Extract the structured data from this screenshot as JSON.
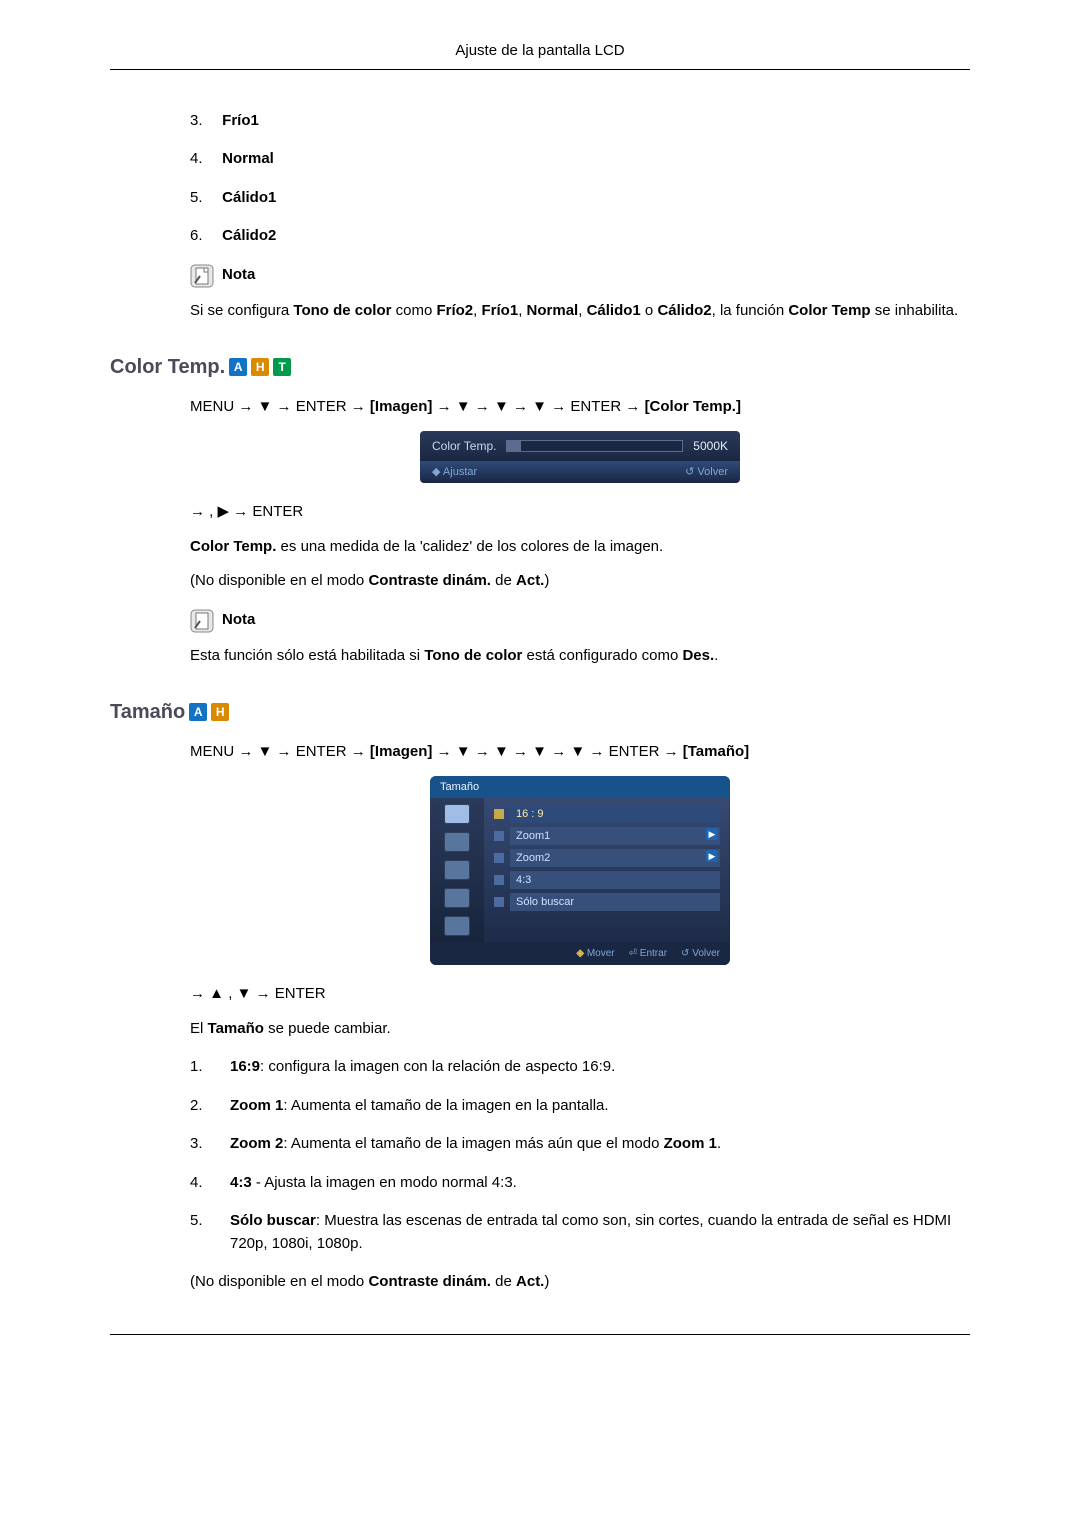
{
  "header": {
    "title": "Ajuste de la pantalla LCD"
  },
  "top_list": {
    "items": [
      {
        "num": "3.",
        "label": "Frío1"
      },
      {
        "num": "4.",
        "label": "Normal"
      },
      {
        "num": "5.",
        "label": "Cálido1"
      },
      {
        "num": "6.",
        "label": "Cálido2"
      }
    ]
  },
  "nota_label": "Nota",
  "top_note": {
    "pre": "Si se configura ",
    "b1": "Tono de color",
    "mid1": " como ",
    "b2": "Frío2",
    "sep12": ", ",
    "b3": "Frío1",
    "sep23": ", ",
    "b4": "Normal",
    "sep34": ", ",
    "b5": "Cálido1",
    "sep45": " o ",
    "b6": "Cálido2",
    "mid2": ", la función ",
    "b7": "Color Temp",
    "post": " se inhabilita."
  },
  "sec_color_temp": {
    "heading": "Color Temp.",
    "badges": [
      "A",
      "H",
      "T"
    ],
    "path": {
      "menu": "MENU",
      "arrow": "→",
      "down": "▼",
      "right": "▶",
      "enter": "ENTER",
      "imagen": "[Imagen]",
      "colortemp": "[Color Temp.]"
    },
    "osd": {
      "label": "Color Temp.",
      "value": "5000K",
      "fill_pct": 8,
      "ajustar": "Ajustar",
      "volver": "Volver"
    },
    "nav2_prefix": "→  , ",
    "nav2_right": "▶",
    "nav2_arrow": " → ",
    "nav2_enter": "ENTER",
    "p1_b": "Color Temp.",
    "p1_rest": " es una medida de la 'calidez' de los colores de la imagen.",
    "p2_pre": "(No disponible en el modo ",
    "p2_b1": "Contraste dinám.",
    "p2_mid": " de ",
    "p2_b2": "Act.",
    "p2_post": ")",
    "p3_pre": "Esta función sólo está habilitada si ",
    "p3_b1": "Tono de color",
    "p3_mid": " está configurado como ",
    "p3_b2": "Des.",
    "p3_post": "."
  },
  "sec_tamano": {
    "heading": "Tamaño",
    "badges": [
      "A",
      "H"
    ],
    "path": {
      "menu": "MENU",
      "arrow": "→",
      "down": "▼",
      "enter": "ENTER",
      "imagen": "[Imagen]",
      "tamano": "[Tamaño]"
    },
    "osd": {
      "title": "Tamaño",
      "options": [
        {
          "label": "16 : 9",
          "selected": true,
          "arrow": false
        },
        {
          "label": "Zoom1",
          "selected": false,
          "arrow": true
        },
        {
          "label": "Zoom2",
          "selected": false,
          "arrow": true
        },
        {
          "label": "4:3",
          "selected": false,
          "arrow": false
        },
        {
          "label": "Sólo buscar",
          "selected": false,
          "arrow": false
        }
      ],
      "mover": "Mover",
      "entrar": "Entrar",
      "volver": "Volver"
    },
    "nav2": {
      "arrow": "→",
      "up": "▲",
      "comma": " , ",
      "down": "▼",
      "enter": "ENTER"
    },
    "p1_pre": "El ",
    "p1_b": "Tamaño",
    "p1_post": " se puede cambiar.",
    "items": [
      {
        "num": "1.",
        "b": "16:9",
        "rest": ": configura la imagen con la relación de aspecto 16:9."
      },
      {
        "num": "2.",
        "b": "Zoom 1",
        "rest": ": Aumenta el tamaño de la imagen en la pantalla."
      },
      {
        "num": "3.",
        "b": "Zoom 2",
        "rest": ": Aumenta el tamaño de la imagen más aún que el modo ",
        "b2": "Zoom 1",
        "rest2": "."
      },
      {
        "num": "4.",
        "b": "4:3",
        "rest": " - Ajusta la imagen en modo normal 4:3."
      },
      {
        "num": "5.",
        "b": "Sólo buscar",
        "rest": ": Muestra las escenas de entrada tal como son, sin cortes, cuando la entrada de señal es HDMI 720p, 1080i, 1080p."
      }
    ],
    "p_last_pre": "(No disponible en el modo ",
    "p_last_b1": "Contraste dinám.",
    "p_last_mid": " de ",
    "p_last_b2": "Act.",
    "p_last_post": ")"
  }
}
